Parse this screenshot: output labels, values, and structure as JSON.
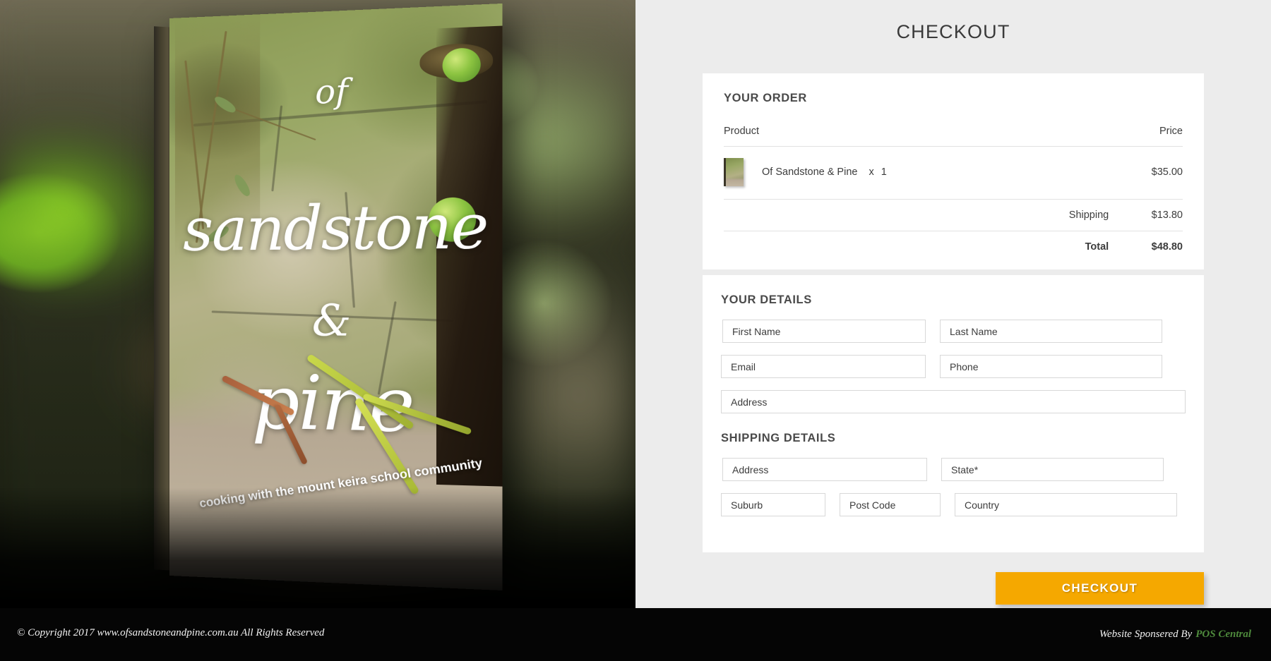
{
  "header": {
    "title": "CHECKOUT"
  },
  "book_cover": {
    "line1": "of",
    "line2": "sandstone",
    "line3": "&",
    "line4": "pine",
    "tagline": "cooking with the mount keira school community"
  },
  "order": {
    "heading": "YOUR ORDER",
    "columns": {
      "product": "Product",
      "price": "Price"
    },
    "items": [
      {
        "name": "Of Sandstone & Pine",
        "qty_symbol": "x",
        "qty": "1",
        "price": "$35.00",
        "thumb_icon": "book-cover-thumbnail"
      }
    ],
    "shipping_label": "Shipping",
    "shipping_value": "$13.80",
    "total_label": "Total",
    "total_value": "$48.80"
  },
  "your_details": {
    "heading": "YOUR DETAILS",
    "fields": {
      "first_name": {
        "placeholder": "First Name",
        "value": ""
      },
      "last_name": {
        "placeholder": "Last Name",
        "value": ""
      },
      "email": {
        "placeholder": "Email",
        "value": ""
      },
      "phone": {
        "placeholder": "Phone",
        "value": ""
      },
      "address": {
        "placeholder": "Address",
        "value": ""
      }
    }
  },
  "shipping_details": {
    "heading": "SHIPPING DETAILS",
    "fields": {
      "address": {
        "placeholder": "Address",
        "value": ""
      },
      "state": {
        "placeholder": "State*",
        "value": ""
      },
      "suburb": {
        "placeholder": "Suburb",
        "value": ""
      },
      "post_code": {
        "placeholder": "Post Code",
        "value": ""
      },
      "country": {
        "placeholder": "Country",
        "value": ""
      }
    }
  },
  "actions": {
    "checkout_label": "CHECKOUT"
  },
  "footer": {
    "copyright": "© Copyright 2017 www.ofsandstoneandpine.com.au All Rights Reserved",
    "sponsor_prefix": "Website Sponsered By",
    "sponsor_brand": "POS Central"
  },
  "colors": {
    "accent_orange": "#f5a800",
    "panel_bg": "#ececec",
    "card_bg": "#ffffff",
    "footer_bg": "#050505",
    "sponsor_green": "#4e8a3c",
    "text_dark": "#3c3c3c"
  }
}
